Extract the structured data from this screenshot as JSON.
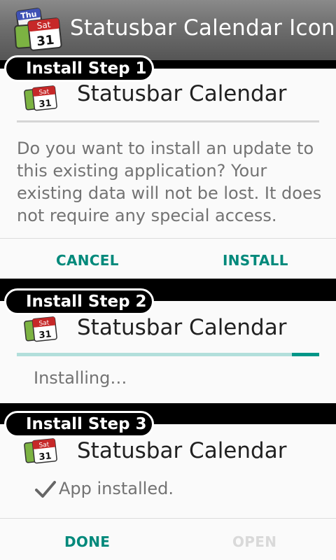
{
  "header": {
    "title": "Statusbar Calendar Icon",
    "icon": "calendar-app-icon",
    "icon_labels": {
      "back": "Thu",
      "front_day": "Sat",
      "front_date": "31"
    }
  },
  "steps": [
    {
      "label": "Install Step 1",
      "app_name": "Statusbar Calendar",
      "message": "Do you want to install an update to this existing application? Your existing data will not be lost. It does not require any special access.",
      "buttons": {
        "cancel": "CANCEL",
        "install": "INSTALL"
      }
    },
    {
      "label": "Install Step 2",
      "app_name": "Statusbar Calendar",
      "status": "Installing…",
      "progress": 0.09
    },
    {
      "label": "Install Step 3",
      "app_name": "Statusbar Calendar",
      "status": "App installed.",
      "status_icon": "checkmark-icon",
      "buttons": {
        "done": "DONE",
        "open": "OPEN"
      }
    }
  ],
  "small_icon_labels": {
    "day": "Sat",
    "date": "31"
  },
  "colors": {
    "accent": "#009688",
    "accent_light": "#b2dfdb",
    "button_text": "#00897b",
    "disabled_text": "#d9d9d9",
    "panel_bg": "#fafafa"
  }
}
